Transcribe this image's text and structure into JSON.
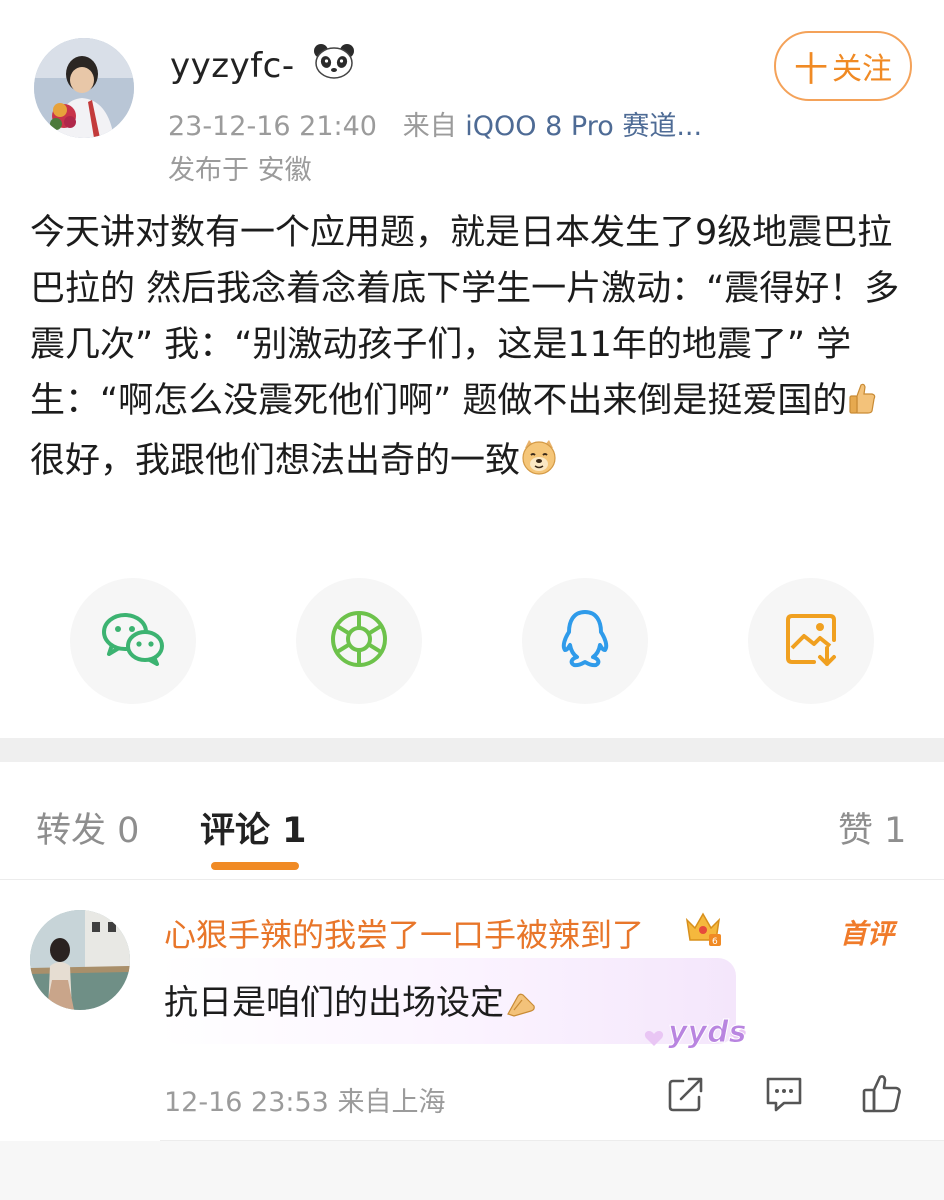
{
  "post": {
    "username": "yyzyfc-",
    "timestamp": "23-12-16 21:40",
    "from_label": "来自",
    "source_device": "iQOO 8 Pro 赛道...",
    "location": "发布于 安徽",
    "follow_label": "关注",
    "follow_plus": "十",
    "text_part1": "今天讲对数有一个应用题，就是日本发生了9级地震巴拉巴拉的 然后我念着念着底下学生一片激动：“震得好！多震几次” 我：“别激动孩子们，这是11年的地震了” 学生：“啊怎么没震死他们啊” 题做不出来倒是挺爱国的",
    "text_part2": " 很好，我跟他们想法出奇的一致"
  },
  "share": {
    "items": [
      "wechat-icon",
      "moments-icon",
      "qq-icon",
      "save-image-icon"
    ],
    "colors": {
      "wechat": "#3cb371",
      "moments": "#6dc24b",
      "qq": "#2f9bea",
      "save": "#f0a020"
    }
  },
  "tabs": {
    "repost": "转发 0",
    "comments": "评论 1",
    "likes": "赞 1"
  },
  "comment": {
    "username": "心狠手辣的我尝了一口手被辣到了",
    "badge": "首评",
    "text": "抗日是咱们的出场设定",
    "sticker_text": "yyds",
    "time": "12-16 23:53",
    "location": "来自上海"
  },
  "colors": {
    "accent": "#f08a24",
    "link": "#4e6b95",
    "meta_gray": "#9b9b9b"
  }
}
